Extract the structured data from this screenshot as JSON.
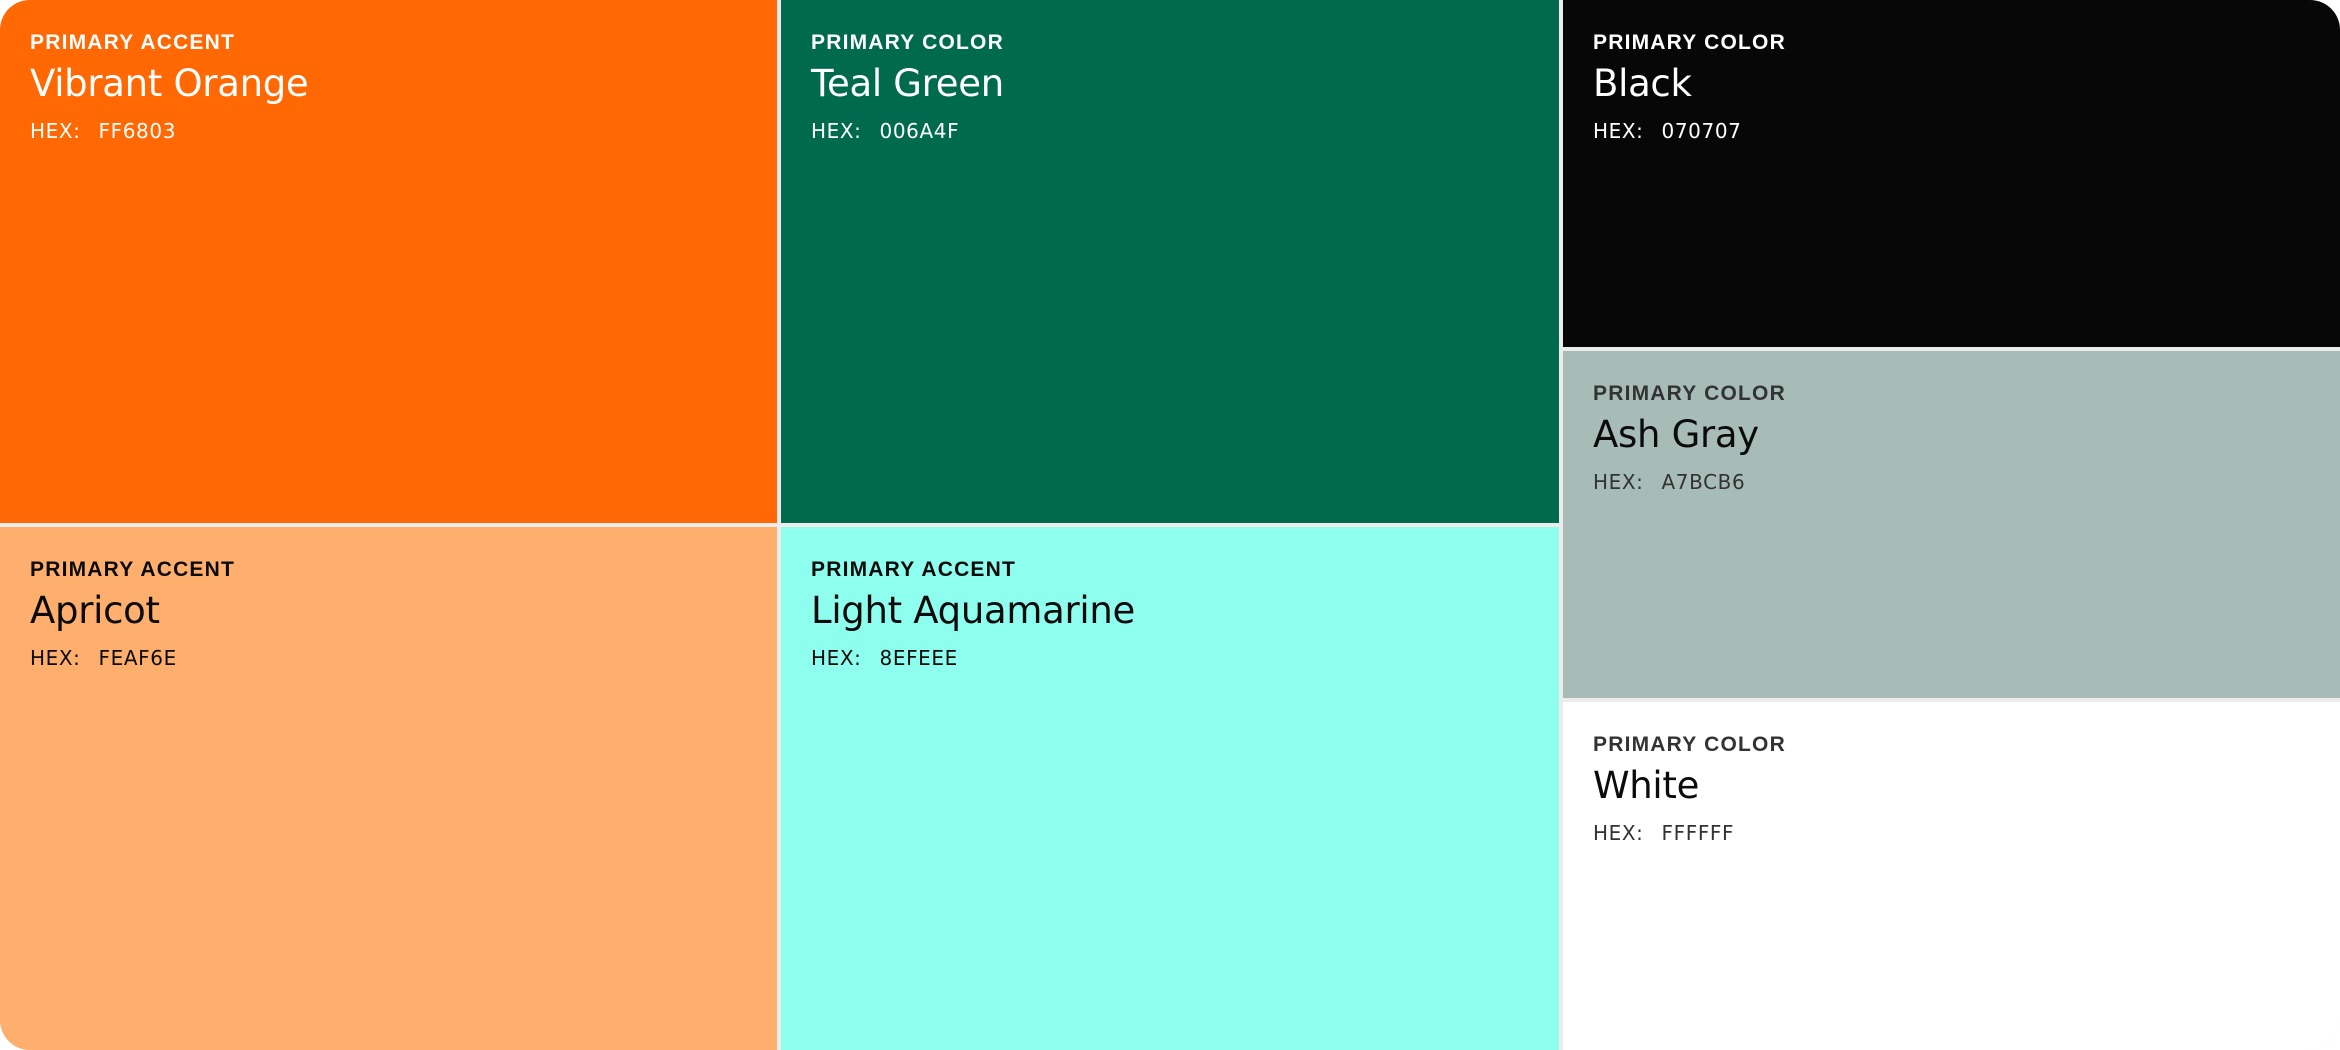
{
  "hex_prefix": "HEX:",
  "swatches": {
    "vibrant_orange": {
      "label": "PRIMARY ACCENT",
      "name": "Vibrant Orange",
      "hex": "FF6803",
      "color": "#FF6803"
    },
    "teal_green": {
      "label": "PRIMARY COLOR",
      "name": "Teal Green",
      "hex": "006A4F",
      "color": "#006A4F"
    },
    "black": {
      "label": "PRIMARY COLOR",
      "name": "Black",
      "hex": "070707",
      "color": "#070707"
    },
    "apricot": {
      "label": "PRIMARY ACCENT",
      "name": "Apricot",
      "hex": "FEAF6E",
      "color": "#FEAF6E"
    },
    "light_aquamarine": {
      "label": "PRIMARY ACCENT",
      "name": "Light Aquamarine",
      "hex": "8EFEEE",
      "color": "#8EFEEE"
    },
    "ash_gray": {
      "label": "PRIMARY COLOR",
      "name": "Ash Gray",
      "hex": "A7BCB6",
      "color": "#A7BCB6"
    },
    "white": {
      "label": "PRIMARY COLOR",
      "name": "White",
      "hex": "FFFFFF",
      "color": "#FFFFFF"
    }
  }
}
